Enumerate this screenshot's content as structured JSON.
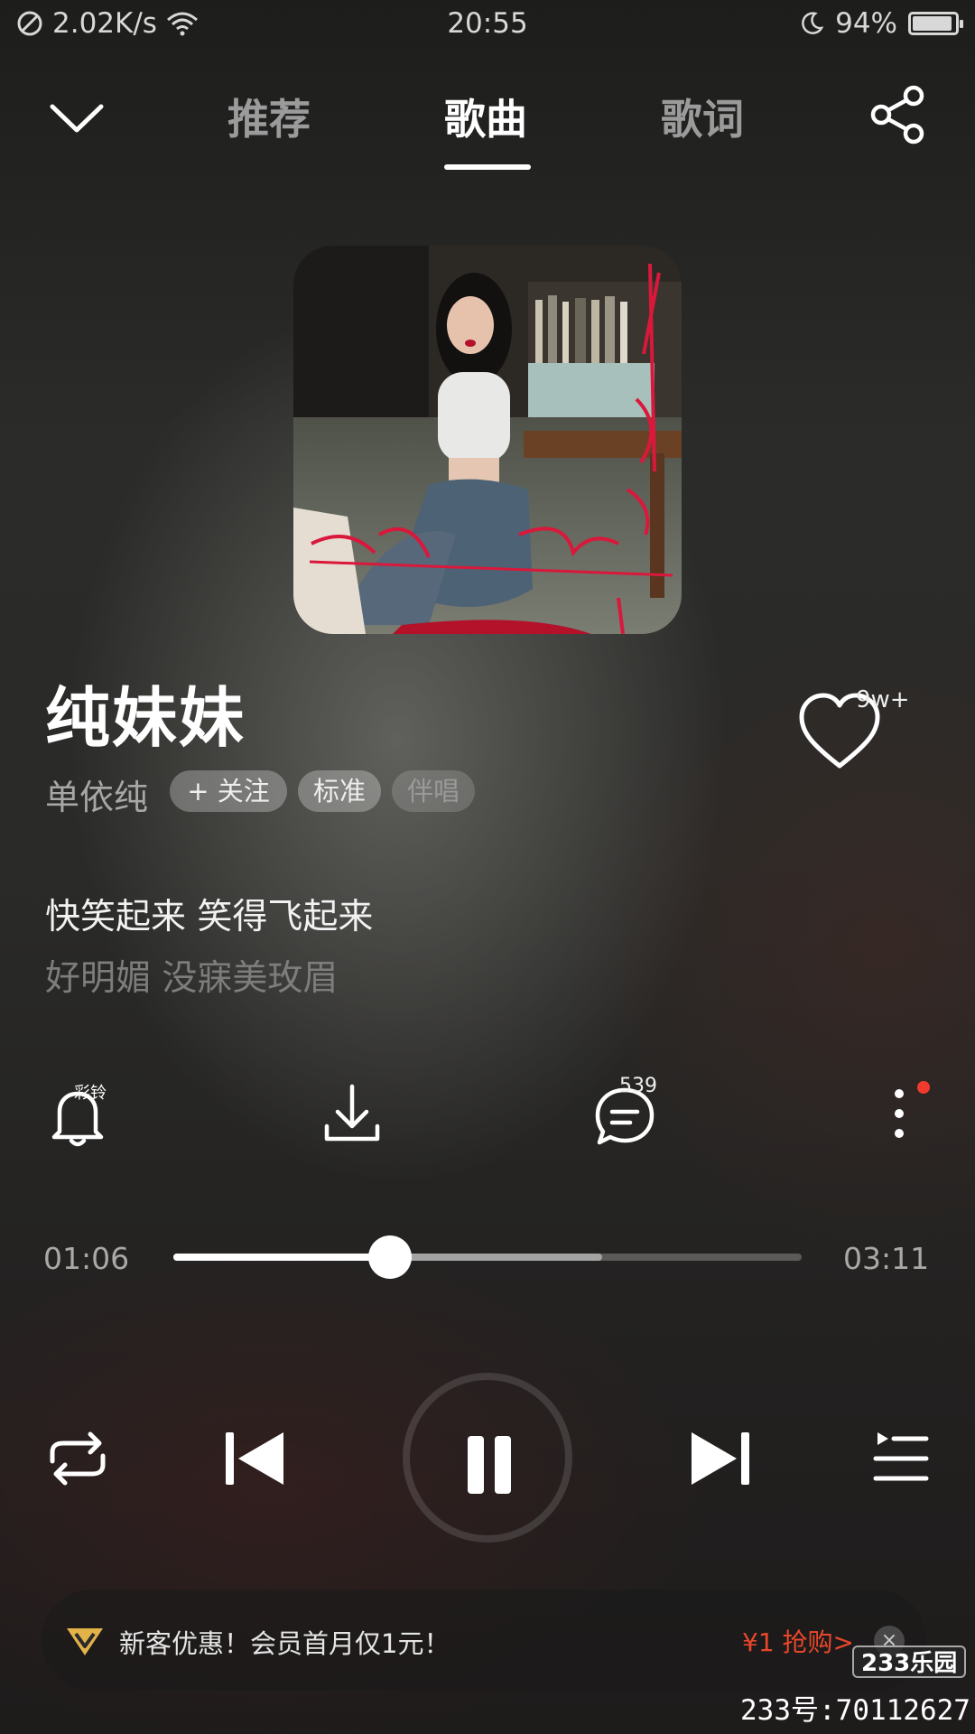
{
  "status_bar": {
    "network_speed": "2.02K/s",
    "time": "20:55",
    "battery_percent": "94%",
    "battery_level": 0.94
  },
  "nav": {
    "tabs": [
      {
        "label": "推荐",
        "active": false
      },
      {
        "label": "歌曲",
        "active": true
      },
      {
        "label": "歌词",
        "active": false
      }
    ]
  },
  "song": {
    "title": "纯妹妹",
    "artist": "单依纯",
    "follow_label": "+ 关注",
    "quality_label": "标准",
    "karaoke_label": "伴唱",
    "like_count": "9w+"
  },
  "lyrics": {
    "current": "快笑起来 笑得飞起来",
    "next": "好明媚 没寐美玫眉"
  },
  "actions": {
    "ringtone_label": "彩铃",
    "comment_count": "539",
    "has_new_dot": true
  },
  "progress": {
    "elapsed": "01:06",
    "duration": "03:11",
    "played_fraction": 0.345,
    "buffered_fraction": 0.683
  },
  "promo": {
    "text": "新客优惠！会员首月仅1元！",
    "cta": "¥1 抢购>",
    "close_label": "×"
  },
  "watermark": {
    "logo": "233乐园",
    "id_text": "233号:70112627"
  },
  "colors": {
    "accent_red": "#e8472b",
    "dot_red": "#f03a2e",
    "promo_gold": "#e3b34a"
  }
}
